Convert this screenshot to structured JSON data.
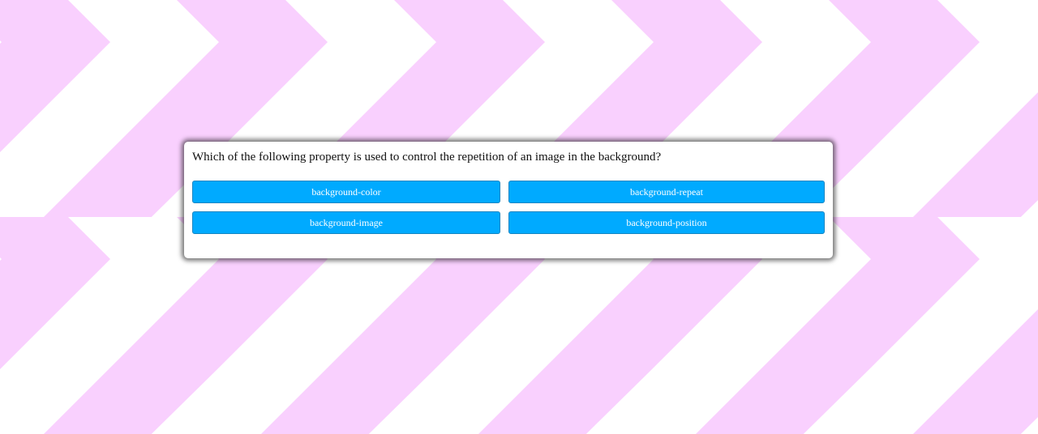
{
  "colors": {
    "background": "#ffffff",
    "chevron": "#f9d0fe",
    "button": "#00aaff",
    "button_border": "#1485c2",
    "button_text": "#ffffff",
    "card": "#ffffff"
  },
  "quiz": {
    "question": "Which of the following property is used to control the repetition of an image in the background?",
    "answers": [
      "background-color",
      "background-repeat",
      "background-image",
      "background-position"
    ]
  }
}
